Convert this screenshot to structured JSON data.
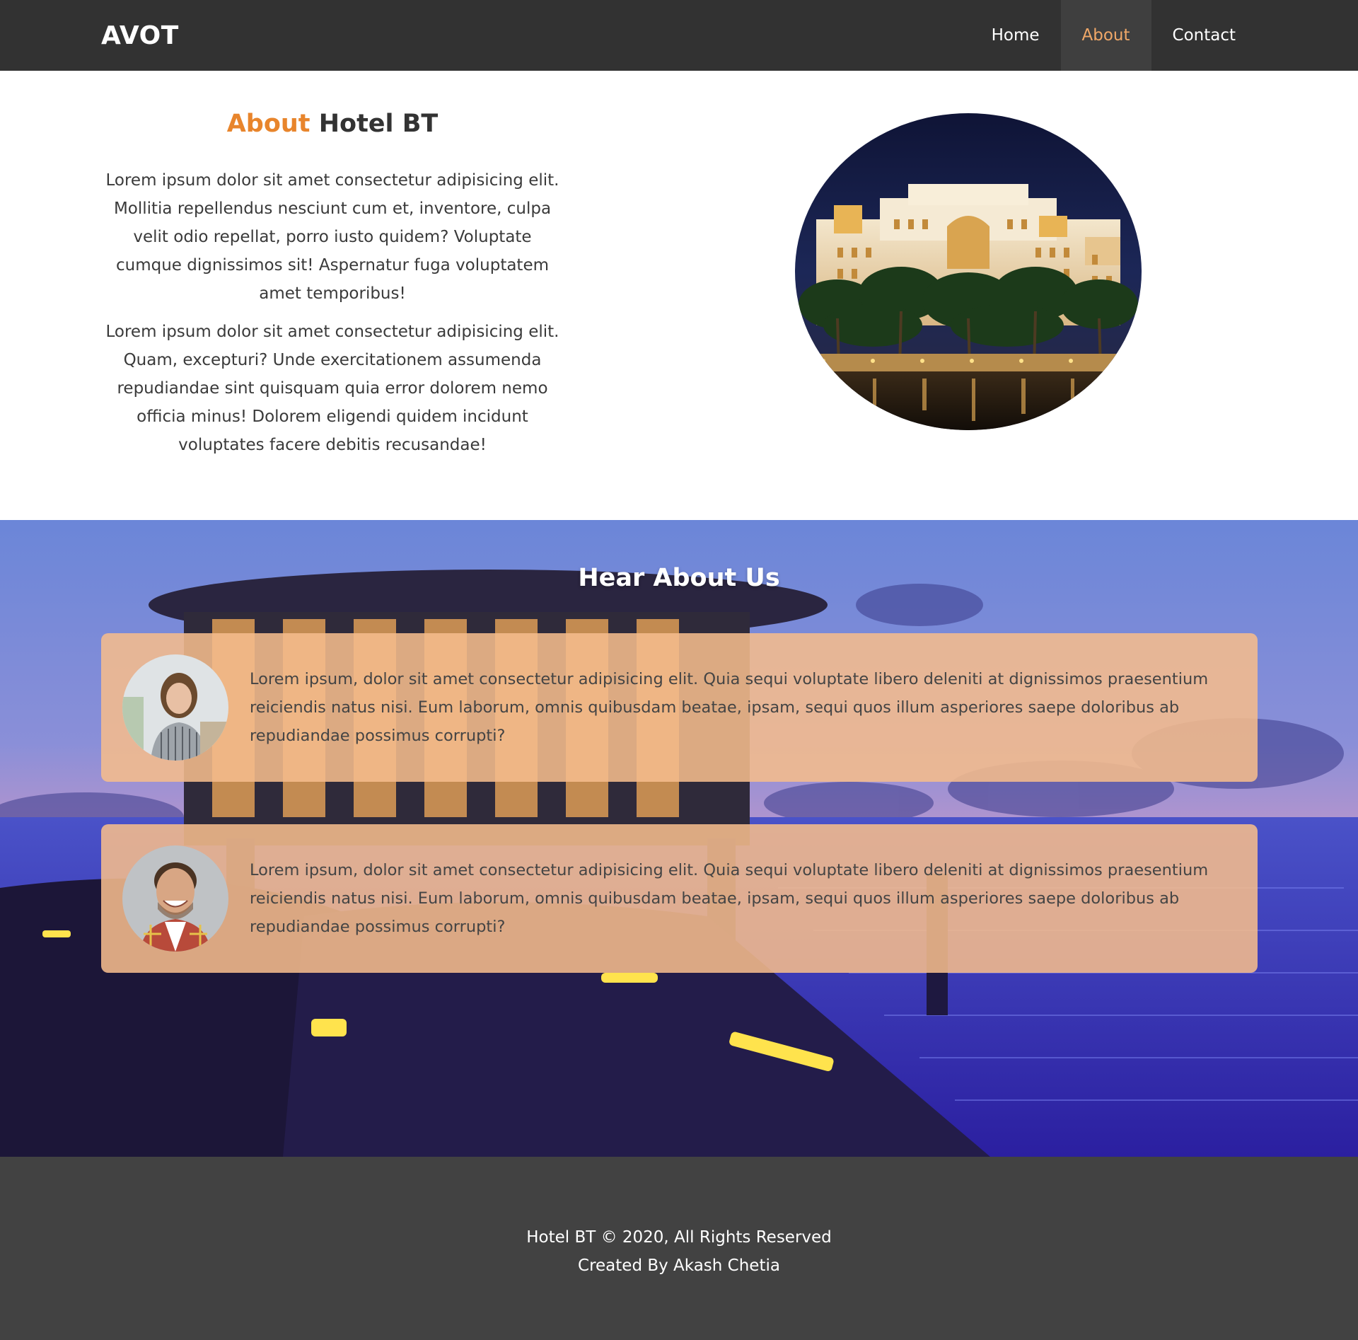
{
  "navbar": {
    "brand": "AVOT",
    "links": [
      {
        "label": "Home",
        "active": false
      },
      {
        "label": "About",
        "active": true
      },
      {
        "label": "Contact",
        "active": false
      }
    ]
  },
  "about": {
    "title_accent": "About",
    "title_rest": "Hotel BT",
    "paragraphs": [
      "Lorem ipsum dolor sit amet consectetur adipisicing elit. Mollitia repellendus nesciunt cum et, inventore, culpa velit odio repellat, porro iusto quidem? Voluptate cumque dignissimos sit! Aspernatur fuga voluptatem amet temporibus!",
      "Lorem ipsum dolor sit amet consectetur adipisicing elit. Quam, excepturi? Unde exercitationem assumenda repudiandae sint quisquam quia error dolorem nemo officia minus! Dolorem eligendi quidem incidunt voluptates facere debitis recusandae!"
    ]
  },
  "reviews": {
    "title": "Hear About Us",
    "items": [
      {
        "text": "Lorem ipsum, dolor sit amet consectetur adipisicing elit. Quia sequi voluptate libero deleniti at dignissimos praesentium reiciendis natus nisi. Eum laborum, omnis quibusdam beatae, ipsam, sequi quos illum asperiores saepe doloribus ab repudiandae possimus corrupti?"
      },
      {
        "text": "Lorem ipsum, dolor sit amet consectetur adipisicing elit. Quia sequi voluptate libero deleniti at dignissimos praesentium reiciendis natus nisi. Eum laborum, omnis quibusdam beatae, ipsam, sequi quos illum asperiores saepe doloribus ab repudiandae possimus corrupti?"
      }
    ]
  },
  "footer": {
    "line1": "Hotel BT © 2020, All Rights Reserved",
    "line2": "Created By Akash Chetia"
  },
  "colors": {
    "navbar_bg": "#323232",
    "accent": "#e8852c",
    "active_link": "#f0a868",
    "card_bg": "#f5bc8c",
    "footer_bg": "#424242"
  }
}
